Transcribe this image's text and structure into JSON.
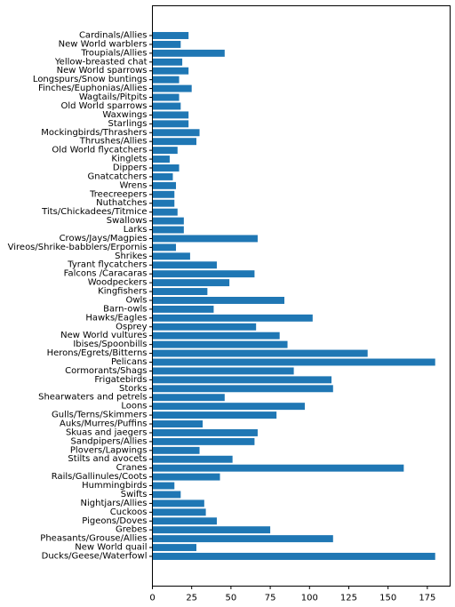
{
  "chart_data": {
    "type": "bar",
    "orientation": "horizontal",
    "title": "",
    "xlabel": "",
    "ylabel": "",
    "xlim": [
      0,
      189.5
    ],
    "xticks": [
      0,
      25,
      50,
      75,
      100,
      125,
      150,
      175
    ],
    "grid": false,
    "legend": null,
    "bar_color": "#1f77b4",
    "categories": [
      "Ducks/Geese/Waterfowl",
      "New World quail",
      "Pheasants/Grouse/Allies",
      "Grebes",
      "Pigeons/Doves",
      "Cuckoos",
      "Nightjars/Allies",
      "Swifts",
      "Hummingbirds",
      "Rails/Gallinules/Coots",
      "Cranes",
      "Stilts and avocets",
      "Plovers/Lapwings",
      "Sandpipers/Allies",
      "Skuas and jaegers",
      "Auks/Murres/Puffins",
      "Gulls/Terns/Skimmers",
      "Loons",
      "Shearwaters and petrels",
      "Storks",
      "Frigatebirds",
      "Cormorants/Shags",
      "Pelicans",
      "Herons/Egrets/Bitterns",
      "Ibises/Spoonbills",
      "New World vultures",
      "Osprey",
      "Hawks/Eagles",
      "Barn-owls",
      "Owls",
      "Kingfishers",
      "Woodpeckers",
      "Falcons /Caracaras",
      "Tyrant flycatchers",
      "Shrikes",
      "Vireos/Shrike-babblers/Erpornis",
      "Crows/Jays/Magpies",
      "Larks",
      "Swallows",
      "Tits/Chickadees/Titmice",
      "Nuthatches",
      "Treecreepers",
      "Wrens",
      "Gnatcatchers",
      "Dippers",
      "Kinglets",
      "Old World flycatchers",
      "Thrushes/Allies",
      "Mockingbirds/Thrashers",
      "Starlings",
      "Waxwings",
      "Old World sparrows",
      "Wagtails/Pitpits",
      "Finches/Euphonias/Allies",
      "Longspurs/Snow buntings",
      "New World sparrows",
      "Yellow-breasted chat",
      "Troupials/Allies",
      "New World warblers",
      "Cardinals/Allies"
    ],
    "values": [
      180,
      28,
      115,
      75,
      41,
      34,
      33,
      18,
      14,
      43,
      160,
      51,
      30,
      65,
      67,
      32,
      79,
      97,
      46,
      115,
      114,
      90,
      180,
      137,
      86,
      81,
      66,
      102,
      39,
      84,
      35,
      49,
      65,
      41,
      24,
      15,
      67,
      20,
      20,
      16,
      14,
      14,
      15,
      13,
      17,
      11,
      16,
      28,
      30,
      23,
      23,
      18,
      17,
      25,
      17,
      23,
      19,
      46,
      18,
      23
    ]
  }
}
